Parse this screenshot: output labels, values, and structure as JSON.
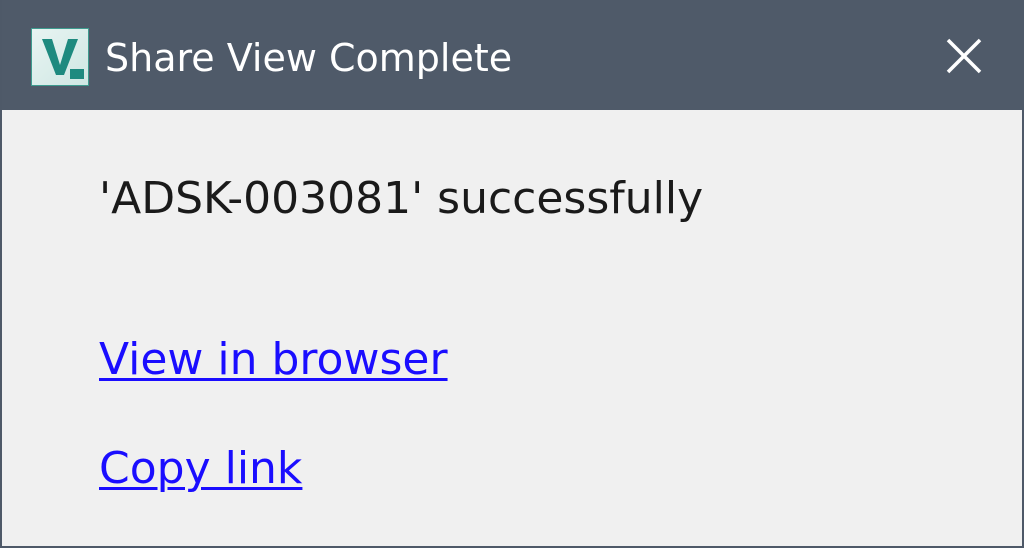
{
  "window": {
    "title": "Share View Complete",
    "app_icon": "autodesk-vault-icon",
    "close_icon": "close-icon"
  },
  "content": {
    "message": "'ADSK-003081' successfully",
    "links": {
      "view_in_browser": "View in browser",
      "copy_link": "Copy link"
    }
  },
  "colors": {
    "titlebar": "#4f5a69",
    "title_text": "#ffffff",
    "body_background": "#f0f0f0",
    "message_text": "#1a1a1a",
    "link_text": "#1a0dff",
    "icon_teal": "#1e8a7f"
  }
}
